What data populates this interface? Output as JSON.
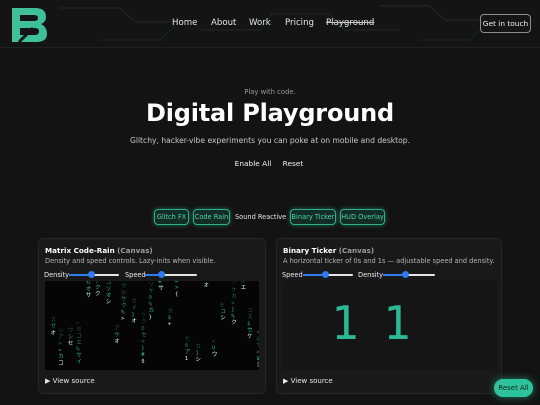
{
  "nav": {
    "items": [
      {
        "label": "Home",
        "active": false
      },
      {
        "label": "About",
        "active": false
      },
      {
        "label": "Work",
        "active": false
      },
      {
        "label": "Pricing",
        "active": false
      },
      {
        "label": "Playground",
        "active": true
      }
    ],
    "cta_label": "Get in touch"
  },
  "hero": {
    "eyebrow": "Play with code.",
    "title": "Digital Playground",
    "subtitle": "Glitchy, hacker-vibe experiments you can poke at on mobile and desktop.",
    "enable_all_label": "Enable All",
    "reset_label": "Reset"
  },
  "filters": [
    {
      "label": "Glitch FX",
      "active": true
    },
    {
      "label": "Code Rain",
      "active": true
    },
    {
      "label": "Sound Reactive",
      "active": false
    },
    {
      "label": "Binary Ticker",
      "active": true
    },
    {
      "label": "HUD Overlay",
      "active": true
    }
  ],
  "cards": {
    "matrix": {
      "title": "Matrix Code-Rain",
      "tag": "(Canvas)",
      "description": "Density and speed controls. Lazy-inits when visible.",
      "density_label": "Density",
      "density_value": 0.44,
      "speed_label": "Speed",
      "speed_value": 0.32,
      "view_source": "View source"
    },
    "binary": {
      "title": "Binary Ticker",
      "tag": "(Canvas)",
      "description": "A horizontal ticker of 0s and 1s — adjustable speed and density.",
      "speed_label": "Speed",
      "speed_value": 0.44,
      "density_label": "Density",
      "density_value": 0.44,
      "digits": [
        "1",
        "1"
      ],
      "view_source": "View source"
    }
  },
  "reset_all_label": "Reset All",
  "colors": {
    "accent": "#2ec49b",
    "slider_blue": "#2f7bf0",
    "background": "#131313",
    "rain_green": "#3fd69f"
  }
}
